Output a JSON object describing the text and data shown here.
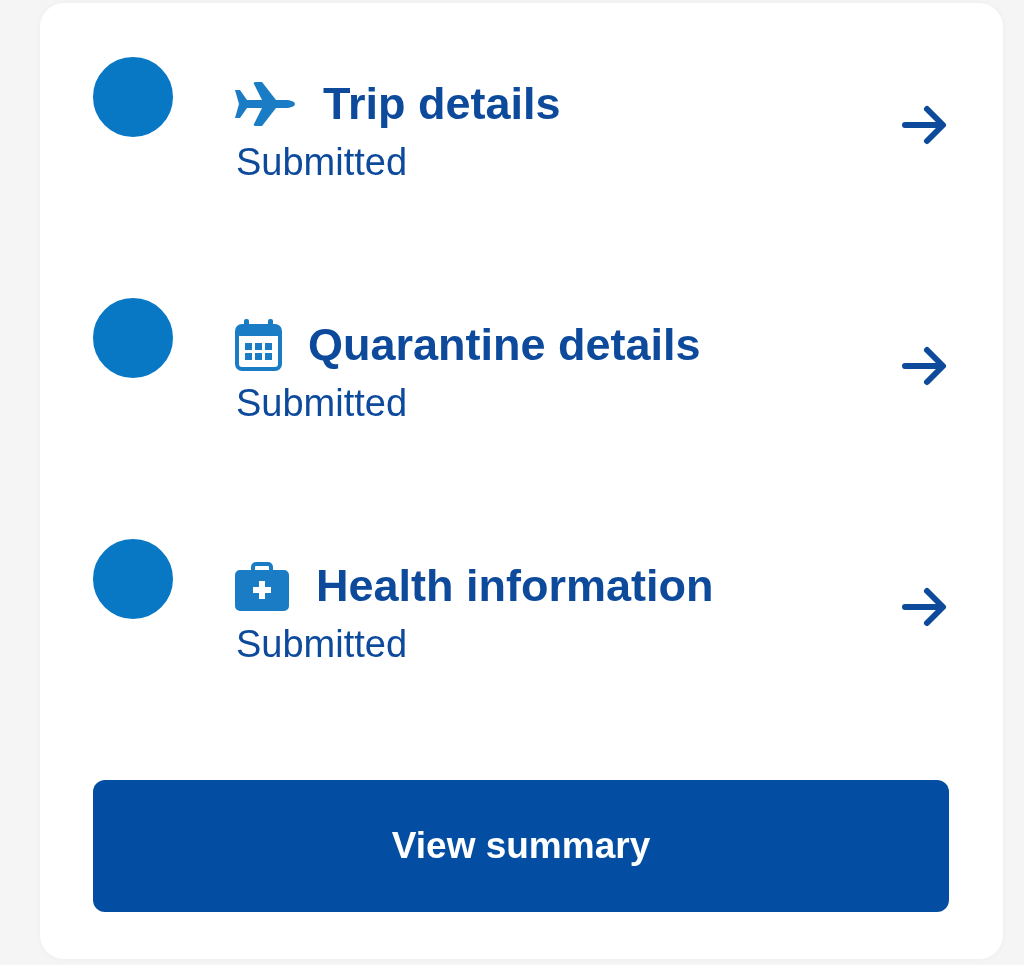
{
  "steps": [
    {
      "kind": "trip",
      "title": "Trip details",
      "status": "Submitted",
      "completed": true
    },
    {
      "kind": "quarantine",
      "title": "Quarantine details",
      "status": "Submitted",
      "completed": true
    },
    {
      "kind": "health",
      "title": "Health information",
      "status": "Submitted",
      "completed": true
    }
  ],
  "button": {
    "label": "View summary"
  }
}
